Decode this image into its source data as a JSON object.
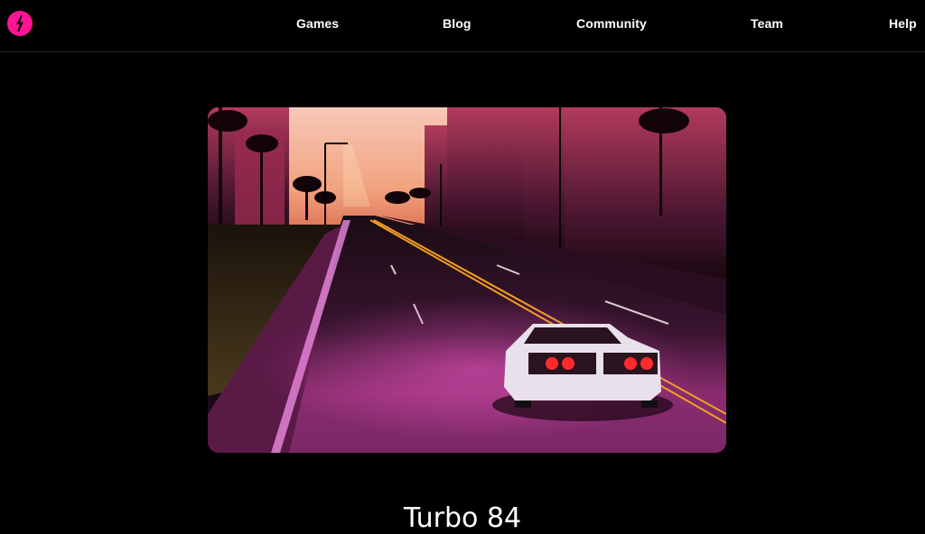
{
  "header": {
    "logo_icon": "lightning-bolt-circle-icon",
    "brand_color": "#ff1493",
    "nav": [
      {
        "label": "Games"
      },
      {
        "label": "Blog"
      },
      {
        "label": "Community"
      },
      {
        "label": "Team"
      },
      {
        "label": "Help"
      }
    ]
  },
  "main": {
    "hero_image_alt": "Synthwave sports car driving down a neon-lit palm-lined highway at sunset",
    "game_title": "Turbo 84"
  }
}
